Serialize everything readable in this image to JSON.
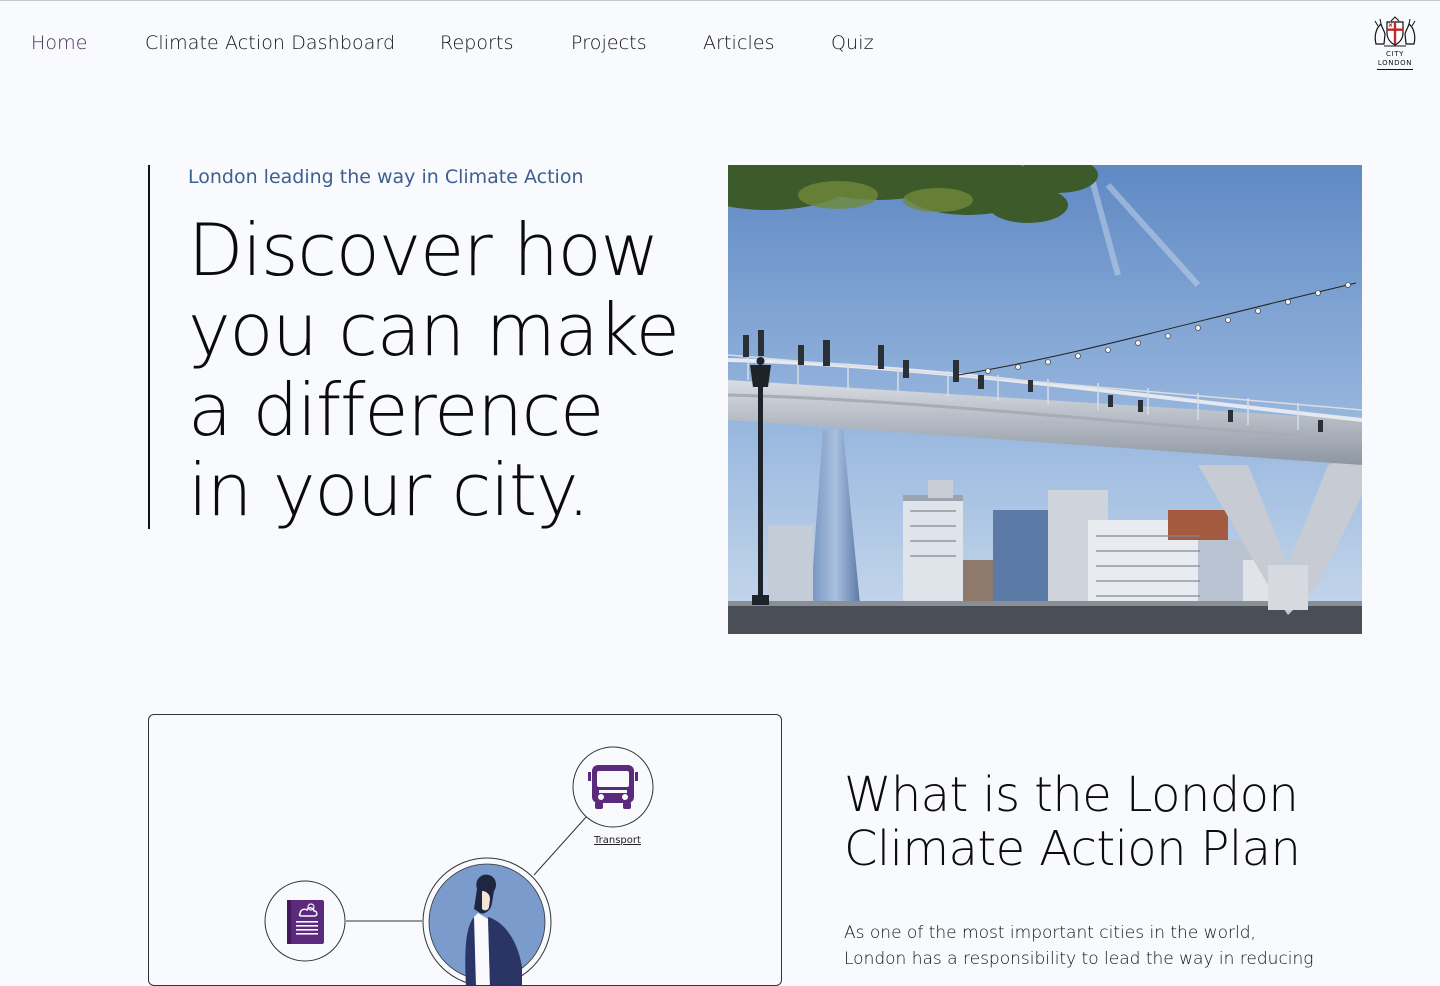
{
  "nav": {
    "items": [
      {
        "label": "Home",
        "active": true
      },
      {
        "label": "Climate Action Dashboard",
        "active": false
      },
      {
        "label": "Reports",
        "active": false
      },
      {
        "label": "Projects",
        "active": false
      },
      {
        "label": "Articles",
        "active": false
      },
      {
        "label": "Quiz",
        "active": false
      }
    ],
    "logo": {
      "line1": "CITY",
      "line2": "LONDON",
      "icon": "city-crest-icon"
    }
  },
  "hero": {
    "kicker": "London leading the way in Climate Action",
    "title": "Discover how you can make a difference in your city.",
    "image_alt": "Millennium Bridge with the Shard and London skyline"
  },
  "card": {
    "nodes": [
      {
        "label": "Transport",
        "icon": "bus-icon"
      },
      {
        "label": "",
        "icon": "weather-report-icon"
      },
      {
        "label": "",
        "icon": "person-avatar-icon"
      }
    ]
  },
  "section": {
    "title": "What is the London Climate Action Plan",
    "body": "As one of the most important cities in the world, London has a responsibility to lead the way in reducing"
  },
  "colors": {
    "background": "#f9fafd",
    "accent_purple": "#5b2a7c",
    "kicker_blue": "#3d5f8f",
    "avatar_blue": "#7b9bcc",
    "navy": "#2a3566"
  }
}
